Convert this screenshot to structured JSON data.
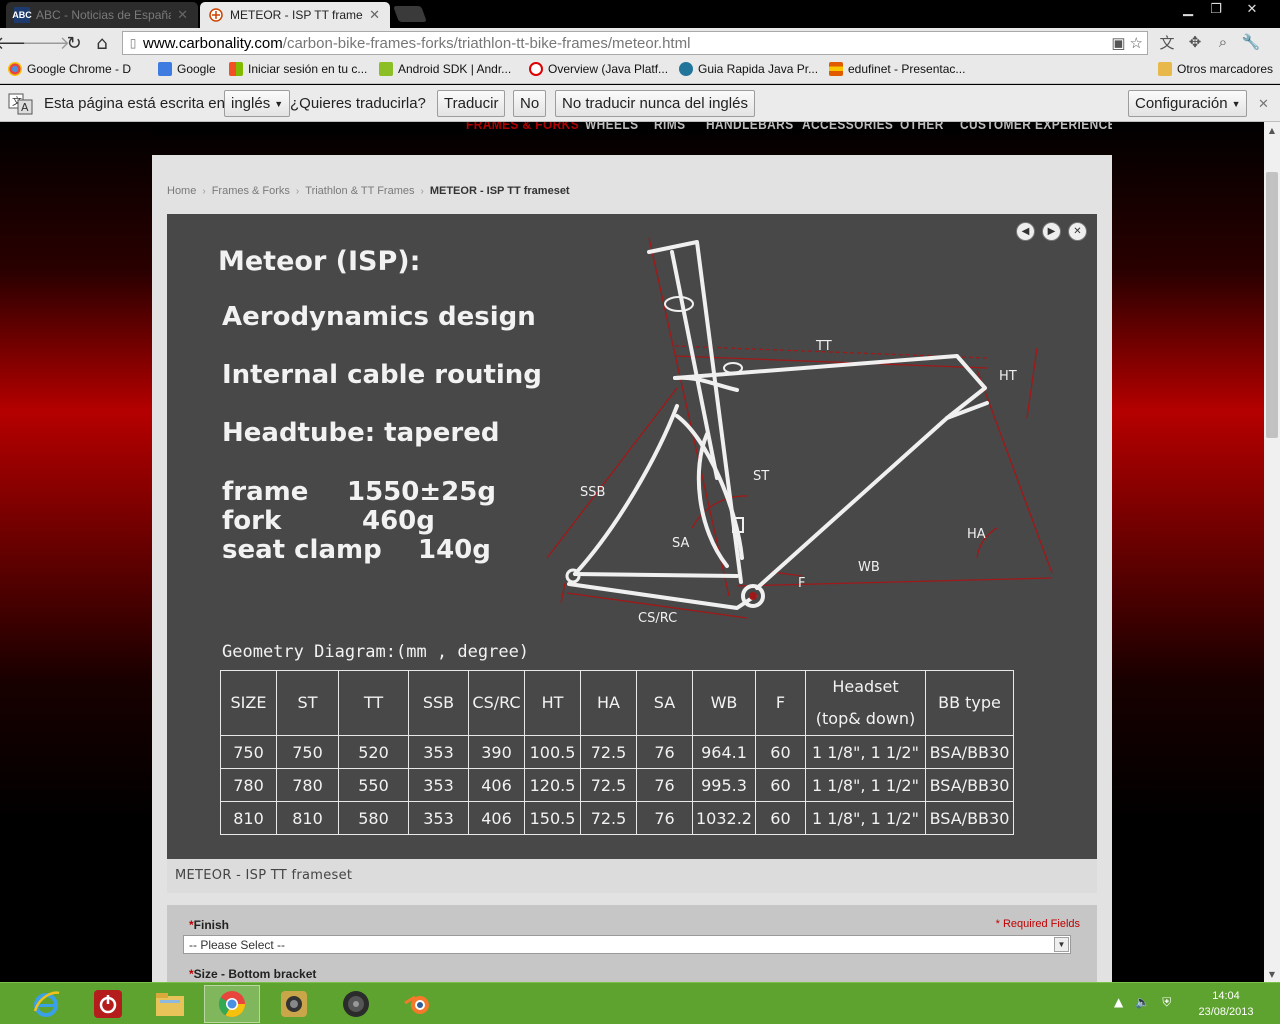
{
  "browser": {
    "tabs": [
      {
        "title": "ABC - Noticias de España",
        "favicon": "ABC",
        "active": false
      },
      {
        "title": "METEOR - ISP TT frameset",
        "active": true
      }
    ],
    "url_host": "www.carbonality.com",
    "url_path": "/carbon-bike-frames-forks/triathlon-tt-bike-frames/meteor.html",
    "bookmarks": [
      "Google Chrome - D",
      "Google",
      "Iniciar sesión en tu c...",
      "Android SDK | Andr...",
      "Overview (Java Platf...",
      "Guia Rapida Java Pr...",
      "edufinet - Presentac..."
    ],
    "other_bookmarks": "Otros marcadores"
  },
  "translate": {
    "prefix": "Esta página está escrita en",
    "language": "inglés",
    "question": "¿Quieres traducirla?",
    "translate_btn": "Traducir",
    "no_btn": "No",
    "never_btn": "No traducir nunca del inglés",
    "settings_btn": "Configuración"
  },
  "nav": [
    "FRAMES & FORKS",
    "WHEELS",
    "RIMS",
    "HANDLEBARS",
    "ACCESSORIES",
    "OTHER",
    "CUSTOMER EXPERIENCE"
  ],
  "breadcrumb": {
    "home": "Home",
    "l1": "Frames & Forks",
    "l2": "Triathlon & TT Frames",
    "current": "METEOR - ISP TT frameset"
  },
  "product": {
    "heading": "Meteor (ISP):",
    "features": [
      "Aerodynamics design",
      "Internal cable routing",
      "Headtube: tapered"
    ],
    "specs": [
      {
        "label": "frame",
        "value": "1550±25g"
      },
      {
        "label": "fork",
        "value": "460g"
      },
      {
        "label": "seat clamp",
        "value": "140g"
      }
    ],
    "diagram_labels": {
      "tt": "TT",
      "ht": "HT",
      "ssb": "SSB",
      "st": "ST",
      "sa": "SA",
      "ha": "HA",
      "wb": "WB",
      "f": "F",
      "csrc": "CS/RC"
    },
    "geometry_title": "Geometry Diagram:(mm , degree)",
    "table": {
      "headers": [
        "SIZE",
        "ST",
        "TT",
        "SSB",
        "CS/RC",
        "HT",
        "HA",
        "SA",
        "WB",
        "F",
        "Headset",
        "BB type"
      ],
      "headset_sub": "(top& down)",
      "rows": [
        [
          "750",
          "750",
          "520",
          "353",
          "390",
          "100.5",
          "72.5",
          "76",
          "964.1",
          "60",
          "1 1/8\", 1 1/2\"",
          "BSA/BB30"
        ],
        [
          "780",
          "780",
          "550",
          "353",
          "406",
          "120.5",
          "72.5",
          "76",
          "995.3",
          "60",
          "1 1/8\", 1 1/2\"",
          "BSA/BB30"
        ],
        [
          "810",
          "810",
          "580",
          "353",
          "406",
          "150.5",
          "72.5",
          "76",
          "1032.2",
          "60",
          "1 1/8\", 1 1/2\"",
          "BSA/BB30"
        ]
      ]
    },
    "caption": "METEOR - ISP TT frameset"
  },
  "options": {
    "finish_label": "Finish",
    "required_note": "* Required Fields",
    "finish_placeholder": "-- Please Select --",
    "size_label": "Size - Bottom bracket"
  },
  "clock": {
    "time": "14:04",
    "date": "23/08/2013"
  }
}
